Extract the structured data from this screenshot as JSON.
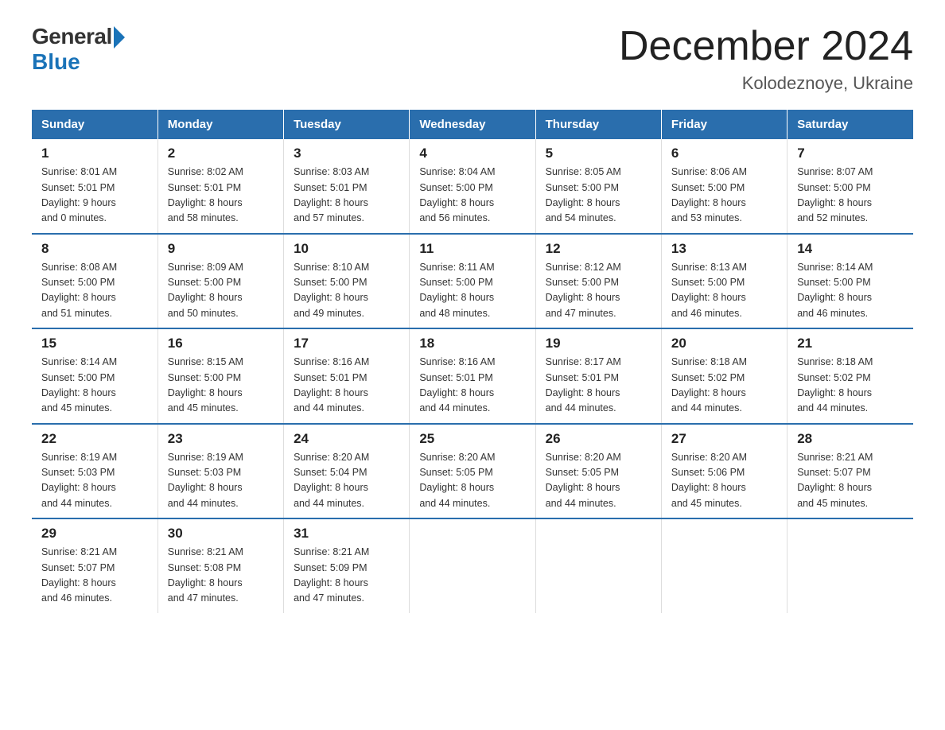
{
  "logo": {
    "general": "General",
    "blue": "Blue"
  },
  "title": "December 2024",
  "location": "Kolodeznoye, Ukraine",
  "days_of_week": [
    "Sunday",
    "Monday",
    "Tuesday",
    "Wednesday",
    "Thursday",
    "Friday",
    "Saturday"
  ],
  "weeks": [
    [
      {
        "day": "1",
        "sunrise": "8:01 AM",
        "sunset": "5:01 PM",
        "daylight": "9 hours and 0 minutes."
      },
      {
        "day": "2",
        "sunrise": "8:02 AM",
        "sunset": "5:01 PM",
        "daylight": "8 hours and 58 minutes."
      },
      {
        "day": "3",
        "sunrise": "8:03 AM",
        "sunset": "5:01 PM",
        "daylight": "8 hours and 57 minutes."
      },
      {
        "day": "4",
        "sunrise": "8:04 AM",
        "sunset": "5:00 PM",
        "daylight": "8 hours and 56 minutes."
      },
      {
        "day": "5",
        "sunrise": "8:05 AM",
        "sunset": "5:00 PM",
        "daylight": "8 hours and 54 minutes."
      },
      {
        "day": "6",
        "sunrise": "8:06 AM",
        "sunset": "5:00 PM",
        "daylight": "8 hours and 53 minutes."
      },
      {
        "day": "7",
        "sunrise": "8:07 AM",
        "sunset": "5:00 PM",
        "daylight": "8 hours and 52 minutes."
      }
    ],
    [
      {
        "day": "8",
        "sunrise": "8:08 AM",
        "sunset": "5:00 PM",
        "daylight": "8 hours and 51 minutes."
      },
      {
        "day": "9",
        "sunrise": "8:09 AM",
        "sunset": "5:00 PM",
        "daylight": "8 hours and 50 minutes."
      },
      {
        "day": "10",
        "sunrise": "8:10 AM",
        "sunset": "5:00 PM",
        "daylight": "8 hours and 49 minutes."
      },
      {
        "day": "11",
        "sunrise": "8:11 AM",
        "sunset": "5:00 PM",
        "daylight": "8 hours and 48 minutes."
      },
      {
        "day": "12",
        "sunrise": "8:12 AM",
        "sunset": "5:00 PM",
        "daylight": "8 hours and 47 minutes."
      },
      {
        "day": "13",
        "sunrise": "8:13 AM",
        "sunset": "5:00 PM",
        "daylight": "8 hours and 46 minutes."
      },
      {
        "day": "14",
        "sunrise": "8:14 AM",
        "sunset": "5:00 PM",
        "daylight": "8 hours and 46 minutes."
      }
    ],
    [
      {
        "day": "15",
        "sunrise": "8:14 AM",
        "sunset": "5:00 PM",
        "daylight": "8 hours and 45 minutes."
      },
      {
        "day": "16",
        "sunrise": "8:15 AM",
        "sunset": "5:00 PM",
        "daylight": "8 hours and 45 minutes."
      },
      {
        "day": "17",
        "sunrise": "8:16 AM",
        "sunset": "5:01 PM",
        "daylight": "8 hours and 44 minutes."
      },
      {
        "day": "18",
        "sunrise": "8:16 AM",
        "sunset": "5:01 PM",
        "daylight": "8 hours and 44 minutes."
      },
      {
        "day": "19",
        "sunrise": "8:17 AM",
        "sunset": "5:01 PM",
        "daylight": "8 hours and 44 minutes."
      },
      {
        "day": "20",
        "sunrise": "8:18 AM",
        "sunset": "5:02 PM",
        "daylight": "8 hours and 44 minutes."
      },
      {
        "day": "21",
        "sunrise": "8:18 AM",
        "sunset": "5:02 PM",
        "daylight": "8 hours and 44 minutes."
      }
    ],
    [
      {
        "day": "22",
        "sunrise": "8:19 AM",
        "sunset": "5:03 PM",
        "daylight": "8 hours and 44 minutes."
      },
      {
        "day": "23",
        "sunrise": "8:19 AM",
        "sunset": "5:03 PM",
        "daylight": "8 hours and 44 minutes."
      },
      {
        "day": "24",
        "sunrise": "8:20 AM",
        "sunset": "5:04 PM",
        "daylight": "8 hours and 44 minutes."
      },
      {
        "day": "25",
        "sunrise": "8:20 AM",
        "sunset": "5:05 PM",
        "daylight": "8 hours and 44 minutes."
      },
      {
        "day": "26",
        "sunrise": "8:20 AM",
        "sunset": "5:05 PM",
        "daylight": "8 hours and 44 minutes."
      },
      {
        "day": "27",
        "sunrise": "8:20 AM",
        "sunset": "5:06 PM",
        "daylight": "8 hours and 45 minutes."
      },
      {
        "day": "28",
        "sunrise": "8:21 AM",
        "sunset": "5:07 PM",
        "daylight": "8 hours and 45 minutes."
      }
    ],
    [
      {
        "day": "29",
        "sunrise": "8:21 AM",
        "sunset": "5:07 PM",
        "daylight": "8 hours and 46 minutes."
      },
      {
        "day": "30",
        "sunrise": "8:21 AM",
        "sunset": "5:08 PM",
        "daylight": "8 hours and 47 minutes."
      },
      {
        "day": "31",
        "sunrise": "8:21 AM",
        "sunset": "5:09 PM",
        "daylight": "8 hours and 47 minutes."
      },
      null,
      null,
      null,
      null
    ]
  ]
}
